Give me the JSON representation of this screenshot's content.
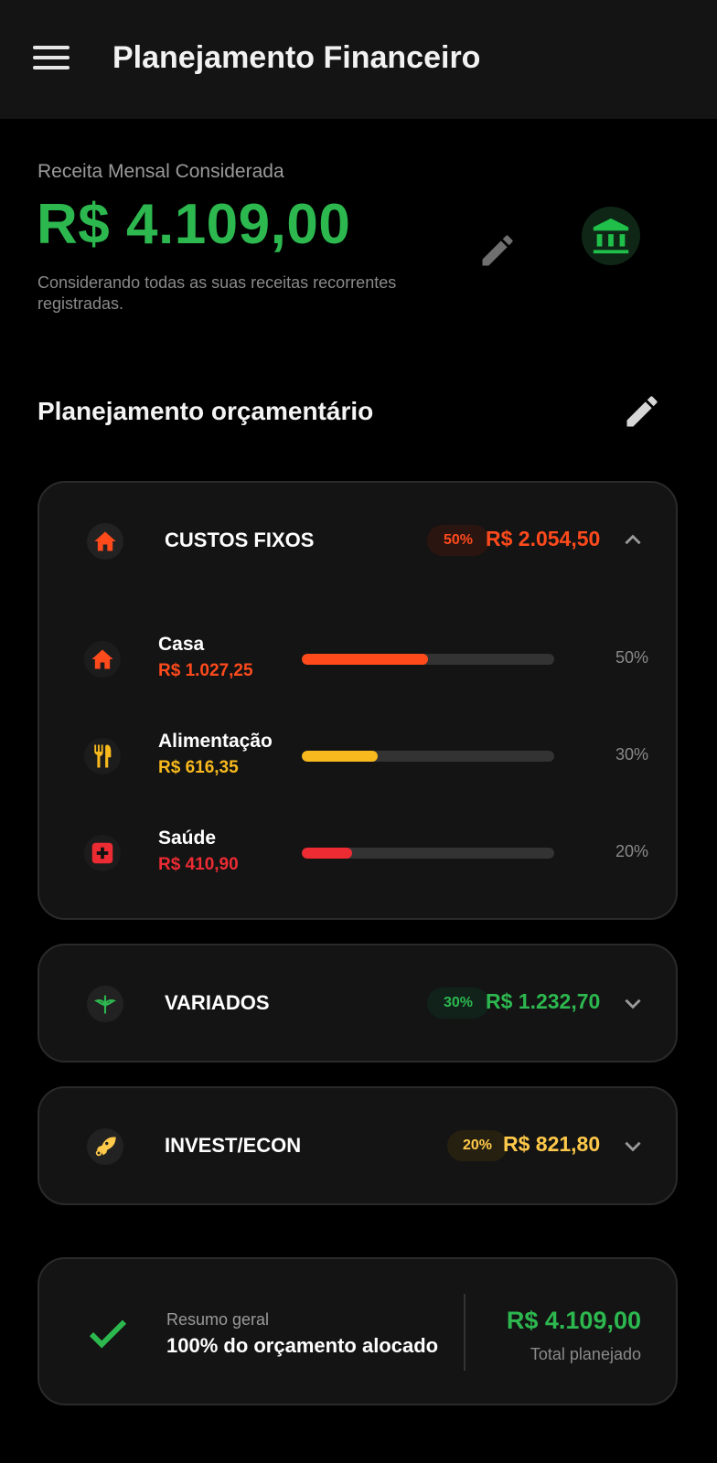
{
  "appbar": {
    "title": "Planejamento Financeiro"
  },
  "income": {
    "label": "Receita Mensal Considerada",
    "value": "R$ 4.109,00",
    "note": "Considerando todas as suas receitas recorrentes registradas."
  },
  "budget": {
    "title": "Planejamento orçamentário",
    "categories": [
      {
        "name": "CUSTOS FIXOS",
        "percent": "50%",
        "amount": "R$ 2.054,50",
        "icon": "home-icon",
        "color": "#ff4a1c",
        "expanded": true,
        "items": [
          {
            "name": "Casa",
            "amount": "R$ 1.027,25",
            "percent": "50%",
            "fill": 0.5,
            "color": "#ff4a1c",
            "icon": "home-icon"
          },
          {
            "name": "Alimentação",
            "amount": "R$ 616,35",
            "percent": "30%",
            "fill": 0.3,
            "color": "#f7b91d",
            "icon": "utensils-icon"
          },
          {
            "name": "Saúde",
            "amount": "R$ 410,90",
            "percent": "20%",
            "fill": 0.2,
            "color": "#ec2b33",
            "icon": "medical-icon"
          }
        ]
      },
      {
        "name": "VARIADOS",
        "percent": "30%",
        "amount": "R$ 1.232,70",
        "icon": "leaf-icon",
        "color": "#2db84f",
        "expanded": false
      },
      {
        "name": "INVEST/ECON",
        "percent": "20%",
        "amount": "R$ 821,80",
        "icon": "rocket-icon",
        "color": "#ffc94a",
        "expanded": false
      }
    ]
  },
  "summary": {
    "label": "Resumo geral",
    "main": "100% do orçamento alocado",
    "amount": "R$ 4.109,00",
    "sub": "Total planejado"
  },
  "colors": {
    "green": "#2db84f",
    "orange": "#ff4a1c",
    "yellow": "#f7b91d",
    "red": "#ec2b33"
  }
}
